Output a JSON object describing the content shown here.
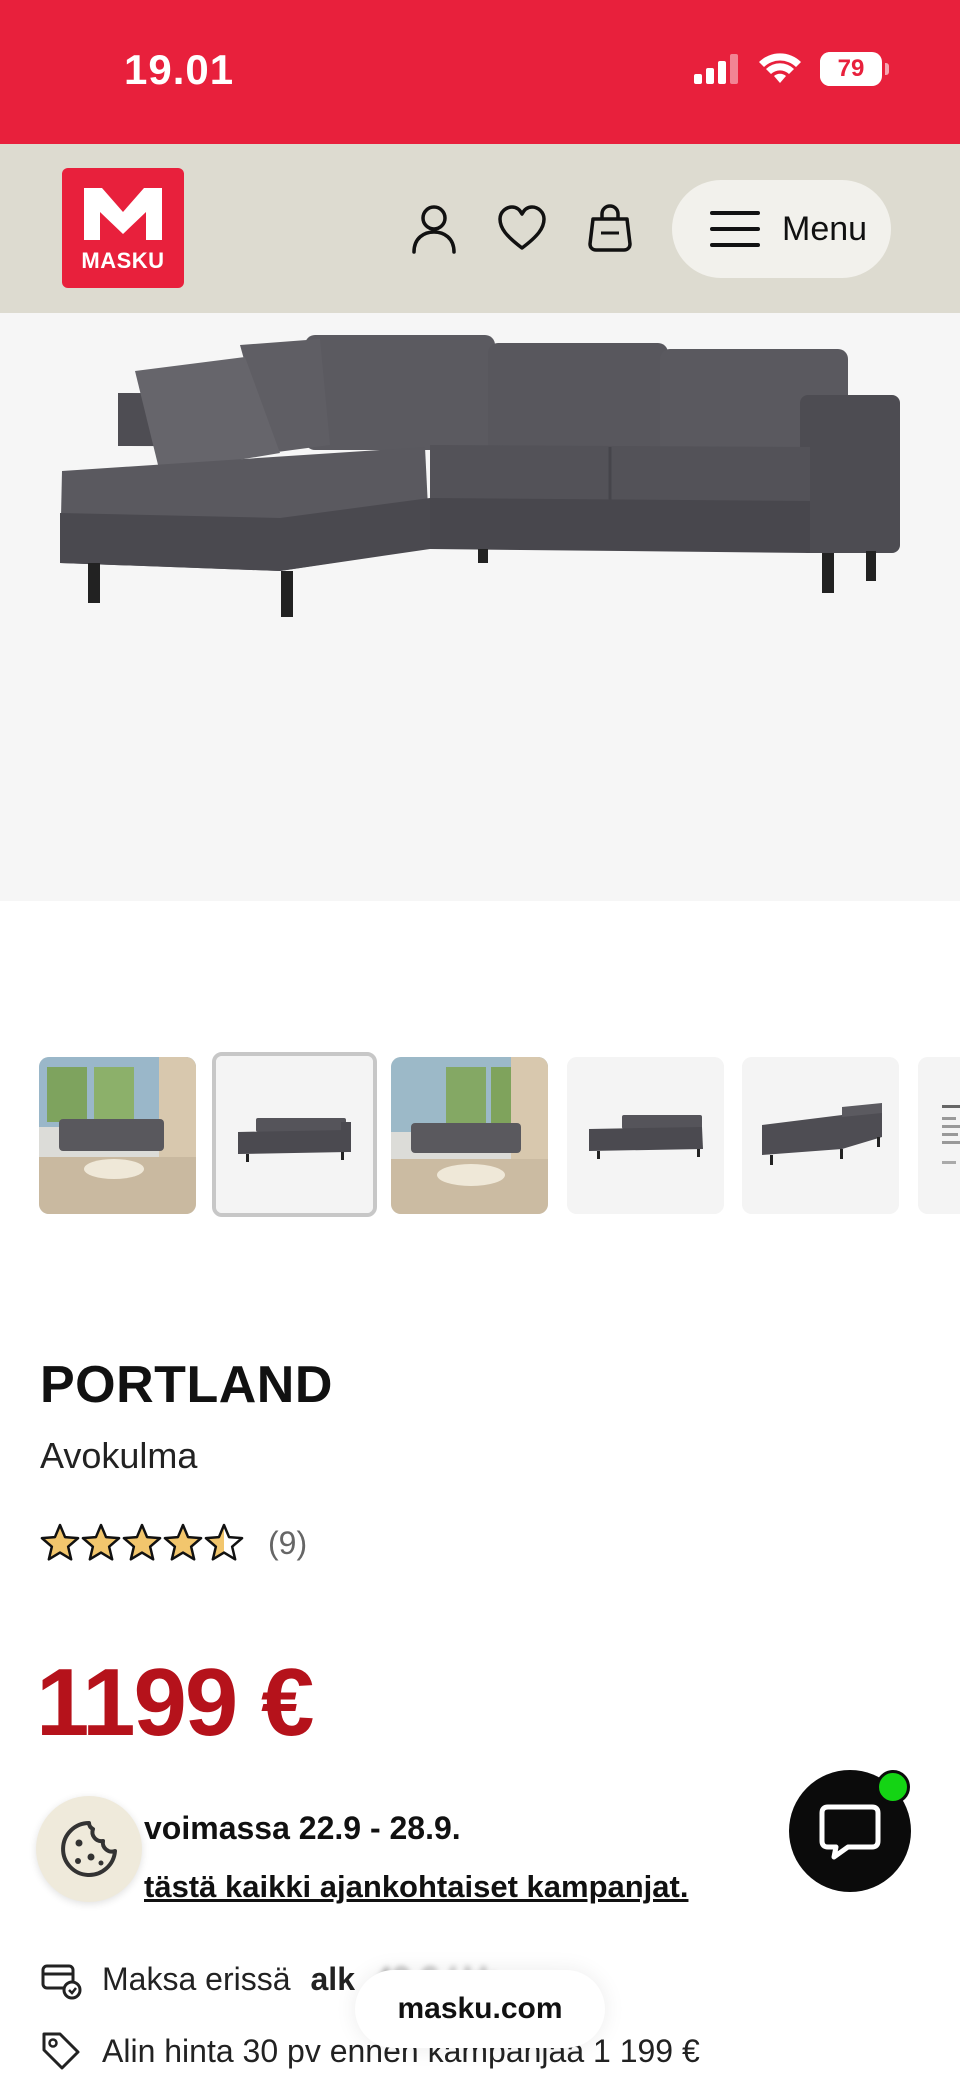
{
  "status_bar": {
    "time": "19.01",
    "battery": "79",
    "battery_level": 0.79,
    "icons": [
      "cellular-signal-icon",
      "wifi-icon",
      "battery-icon"
    ]
  },
  "header": {
    "logo_text": "MASKU",
    "menu_label": "Menu",
    "icons": [
      "account-icon",
      "heart-icon",
      "shopping-bag-icon",
      "hamburger-icon"
    ]
  },
  "product": {
    "name": "PORTLAND",
    "subtitle": "Avokulma",
    "rating": 4.5,
    "review_count": "(9)",
    "price": "1199 €"
  },
  "gallery": {
    "thumbnails": [
      "living-room-photo",
      "sofa-front-photo",
      "living-room-photo-2",
      "sofa-small-photo",
      "sofa-back-photo",
      "info-sheet-photo"
    ],
    "selected_index": 1
  },
  "campaign": {
    "validity": "voimassa 22.9 - 28.9.",
    "link_text": "tästä kaikki ajankohtaiset kampanjat."
  },
  "payment": {
    "label": "Maksa erissä",
    "value": "alk",
    "blurred_value": "49 € / kk"
  },
  "lowest_price": {
    "text": "Alin hinta 30 pv ennen kampanjaa 1 199 €"
  },
  "browser": {
    "url": "masku.com"
  },
  "colors": {
    "brand_red": "#e8203c",
    "price_red": "#b5121b",
    "header_beige": "#dddbd0"
  }
}
